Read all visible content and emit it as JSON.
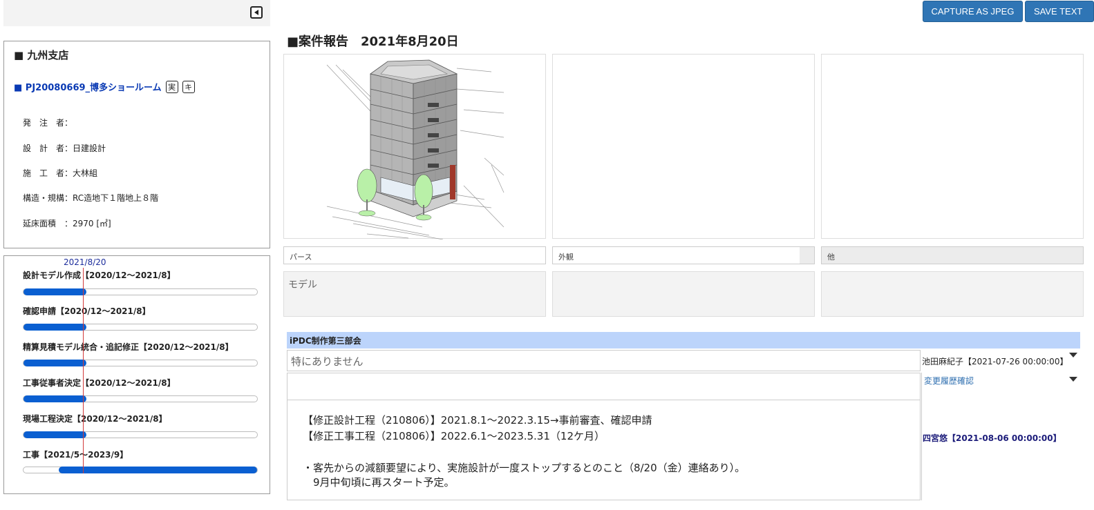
{
  "toolbar": {
    "capture_label": "CAPTURE AS JPEG",
    "save_label": "SAVE TEXT"
  },
  "info": {
    "branch": "■ 九州支店",
    "project": "■ PJ20080669_博多ショールーム",
    "chip_1": "実",
    "chip_2": "キ",
    "rows": [
      {
        "label": "発　注　者：",
        "value": ""
      },
      {
        "label": "設　計　者：",
        "value": "日建設計"
      },
      {
        "label": "施　工　者：",
        "value": "大林組"
      },
      {
        "label": "構造・規構：",
        "value": "RC造地下１階地上８階"
      },
      {
        "label": "延床面積　：",
        "value": "2970 [㎡]"
      }
    ]
  },
  "schedule": {
    "today_label": "2021/8/20",
    "tasks": [
      {
        "label": "設計モデル作成【2020/12～2021/8】",
        "start": 0.0,
        "end": 0.27
      },
      {
        "label": "確認申請【2020/12～2021/8】",
        "start": 0.0,
        "end": 0.27
      },
      {
        "label": "精算見積モデル統合・追記修正【2020/12～2021/8】",
        "start": 0.0,
        "end": 0.27
      },
      {
        "label": "工事従事者決定【2020/12～2021/8】",
        "start": 0.0,
        "end": 0.27
      },
      {
        "label": "現場工程決定【2020/12～2021/8】",
        "start": 0.0,
        "end": 0.27
      },
      {
        "label": "工事【2021/5～2023/9】",
        "start": 0.15,
        "end": 1.0
      }
    ]
  },
  "report": {
    "title": "■案件報告　2021年8月20日",
    "captions": [
      "パース",
      "外観",
      "他"
    ],
    "note_1": "モデル",
    "note_2": "",
    "note_3": ""
  },
  "comments": {
    "department": "iPDC制作第三部会",
    "comment_1": "特にありません",
    "meta_1": "池田麻紀子【2021-07-26 00:00:00】",
    "history_link": "変更履歴確認",
    "comment_2_lines": [
      "【修正設計工程（210806）】2021.8.1～2022.3.15→事前審査、確認申請",
      "【修正工事工程（210806）】2022.6.1～2023.5.31（12ケ月）",
      "",
      "・客先からの減額要望により、実施設計が一度ストップするとのこと（8/20（金）連絡あり）。",
      "　9月中旬頃に再スタート予定。"
    ],
    "author_2": "四宮悠【2021-08-06 00:00:00】"
  }
}
